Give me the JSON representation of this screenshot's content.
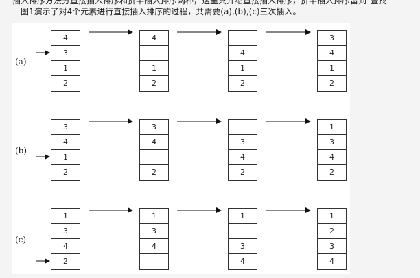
{
  "top_text": "插入排序方法分直接插入排序和折半插入排序两种，这里只介绍直接插入排序，折半插入排序留到\"查找\"",
  "caption": "图1演示了对4个元素进行直接插入排序的过程，共需要(a),(b),(c)三次插入。",
  "rows": [
    {
      "label": "(a)",
      "columns": [
        [
          "4",
          "3",
          "1",
          "2"
        ],
        [
          "4",
          "",
          "1",
          "2"
        ],
        [
          "",
          "4",
          "1",
          "2"
        ],
        [
          "3",
          "4",
          "1",
          "2"
        ]
      ]
    },
    {
      "label": "(b)",
      "columns": [
        [
          "3",
          "4",
          "1",
          "2"
        ],
        [
          "3",
          "4",
          "",
          "2"
        ],
        [
          "",
          "3",
          "4",
          "2"
        ],
        [
          "1",
          "3",
          "4",
          "2"
        ]
      ]
    },
    {
      "label": "(c)",
      "columns": [
        [
          "1",
          "3",
          "4",
          "2"
        ],
        [
          "1",
          "3",
          "4",
          ""
        ],
        [
          "1",
          "",
          "3",
          "4"
        ],
        [
          "1",
          "2",
          "3",
          "4"
        ]
      ]
    }
  ]
}
